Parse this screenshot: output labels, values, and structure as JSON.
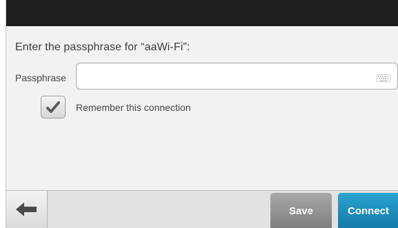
{
  "dialog": {
    "prompt": "Enter the passphrase for “aaWi-Fi”:",
    "passphrase_label": "Passphrase",
    "passphrase_value": "",
    "remember_checked": true,
    "remember_label": "Remember this connection"
  },
  "footer": {
    "back_icon": "arrow-left-icon",
    "save_label": "Save",
    "connect_label": "Connect"
  },
  "colors": {
    "topbar": "#1e1e1e",
    "connect": "#1d8fbf",
    "save": "#8f8f8f"
  }
}
